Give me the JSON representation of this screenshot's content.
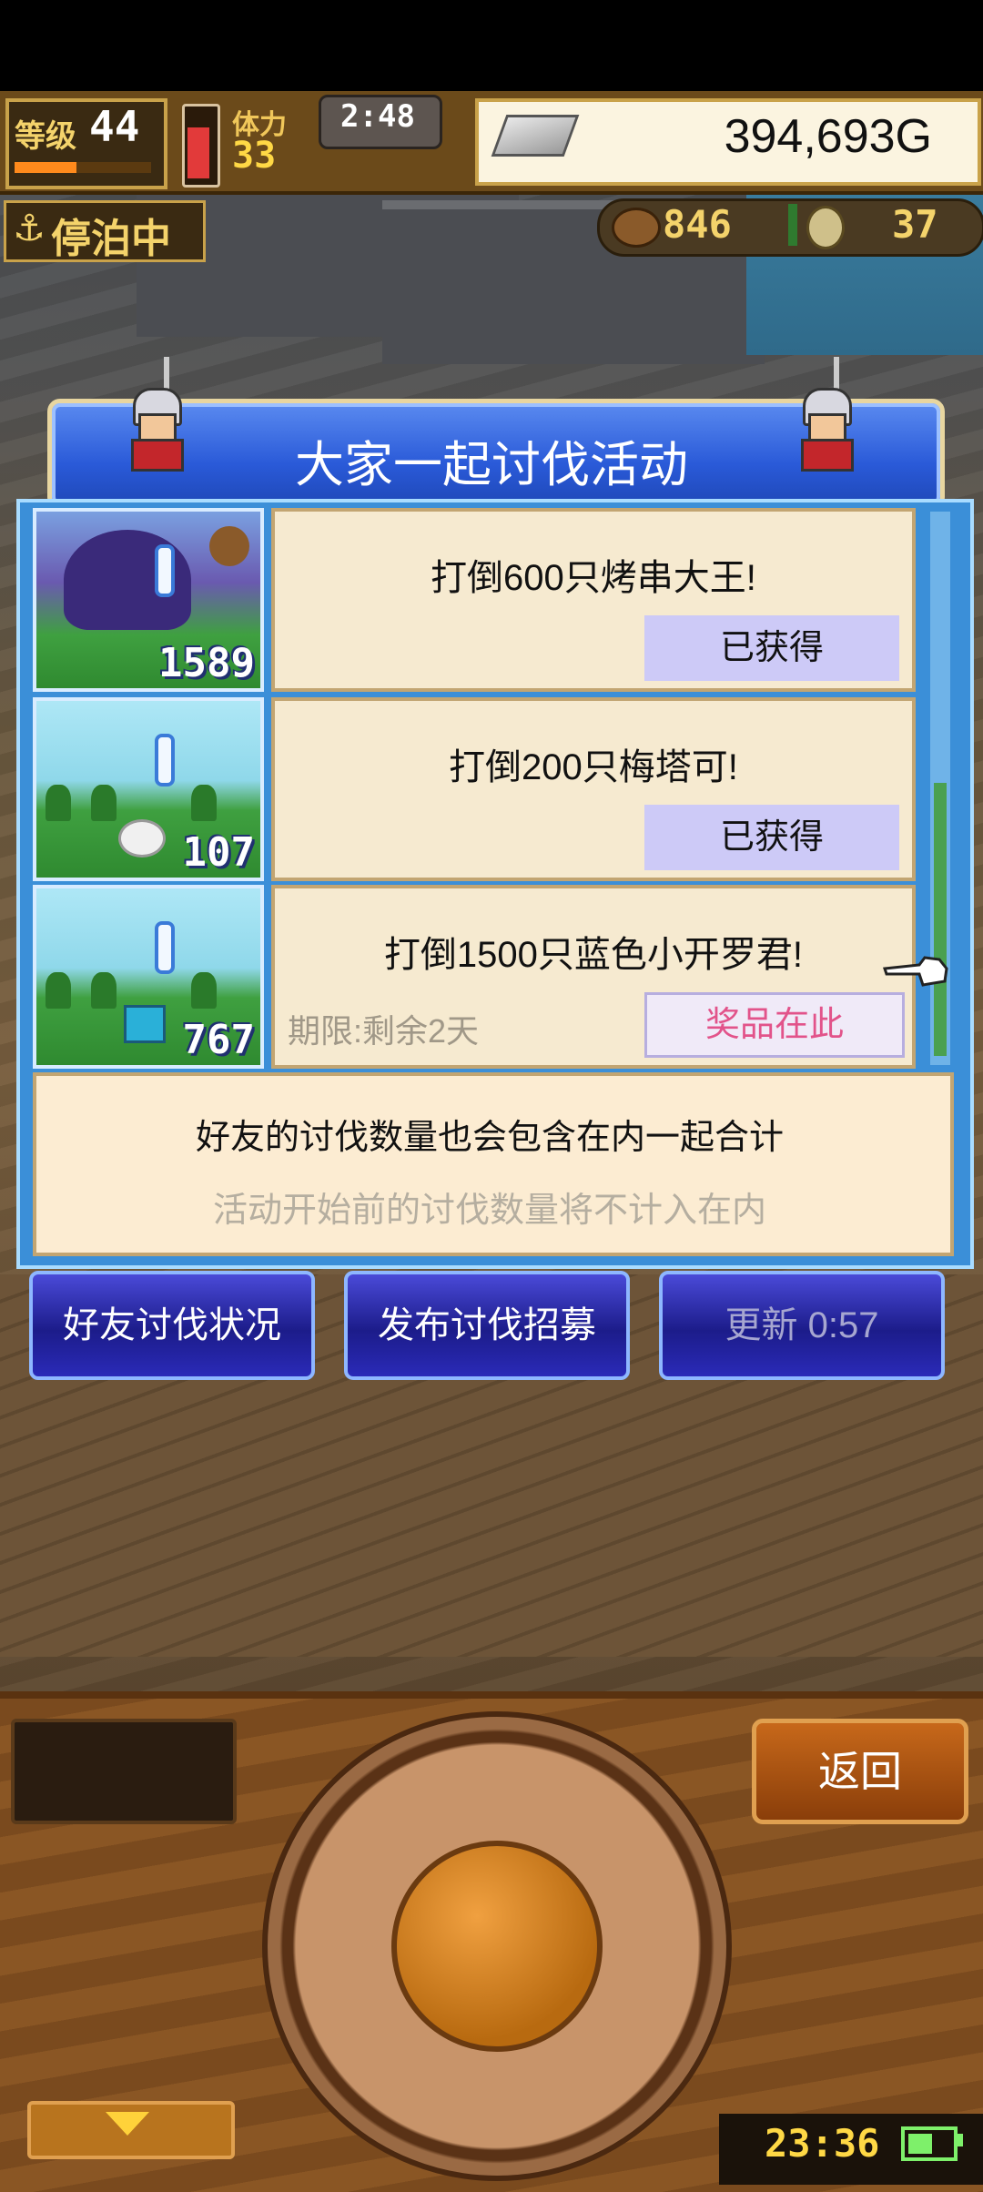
{
  "hud": {
    "level_label": "等级",
    "level": "44",
    "level_progress": 0.45,
    "stamina_label": "体力",
    "stamina": "33",
    "timer": "2:48",
    "gold": "394,693G",
    "dock_status": "停泊中",
    "resource_1": "846",
    "resource_2": "37",
    "icons": [
      "silver-bar-icon",
      "anchor-icon",
      "hand-cannon-icon",
      "coin-icon"
    ]
  },
  "modal": {
    "title": "大家一起讨伐活动",
    "rows": [
      {
        "task": "打倒600只烤串大王!",
        "count": "1589",
        "claim": "已获得",
        "deadline": ""
      },
      {
        "task": "打倒200只梅塔可!",
        "count": "107",
        "claim": "已获得",
        "deadline": ""
      },
      {
        "task": "打倒1500只蓝色小开罗君!",
        "count": "767",
        "claim": "奖品在此",
        "deadline": "期限:剩余2天"
      }
    ],
    "note_primary": "好友的讨伐数量也会包含在内一起合计",
    "note_secondary": "活动开始前的讨伐数量将不计入在内"
  },
  "buttons": {
    "friend_status": "好友讨伐状况",
    "post_recruit": "发布讨伐招募",
    "refresh": "更新 0:57"
  },
  "controls": {
    "back": "返回",
    "clock": "23:36"
  },
  "colors": {
    "title_blue": "#2a5ad8",
    "claim_done": "#cdcaf7",
    "claim_active_text": "#e2538a",
    "button_blue": "#1c1c8a"
  }
}
